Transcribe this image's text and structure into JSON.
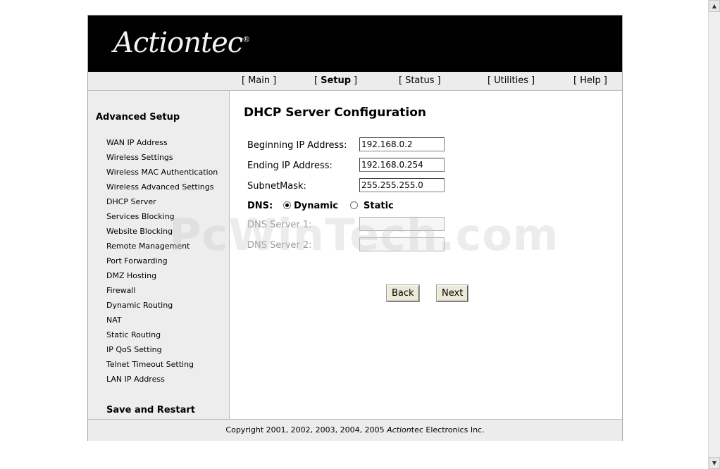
{
  "brand": {
    "logo_text": "Actiontec"
  },
  "topnav": {
    "items": [
      {
        "label": "Main"
      },
      {
        "label": "Setup"
      },
      {
        "label": "Status"
      },
      {
        "label": "Utilities"
      },
      {
        "label": "Help"
      }
    ],
    "active": "Setup"
  },
  "sidebar": {
    "title": "Advanced Setup",
    "items": [
      "WAN IP Address",
      "Wireless Settings",
      "Wireless MAC Authentication",
      "Wireless Advanced Settings",
      "DHCP Server",
      "Services Blocking",
      "Website Blocking",
      "Remote Management",
      "Port Forwarding",
      "DMZ Hosting",
      "Firewall",
      "Dynamic Routing",
      "NAT",
      "Static Routing",
      "IP QoS Setting",
      "Telnet Timeout Setting",
      "LAN IP Address"
    ],
    "save_restart": "Save and Restart"
  },
  "main": {
    "title": "DHCP Server Configuration",
    "fields": {
      "begin_ip": {
        "label": "Beginning IP Address:",
        "value": "192.168.0.2"
      },
      "end_ip": {
        "label": "Ending IP Address:",
        "value": "192.168.0.254"
      },
      "subnet": {
        "label": "SubnetMask:",
        "value": "255.255.255.0"
      },
      "dns1": {
        "label": "DNS Server 1:",
        "value": ""
      },
      "dns2": {
        "label": "DNS Server 2:",
        "value": ""
      }
    },
    "dns": {
      "label": "DNS:",
      "options": [
        "Dynamic",
        "Static"
      ],
      "selected": "Dynamic"
    },
    "buttons": {
      "back": "Back",
      "next": "Next"
    }
  },
  "footer": {
    "prefix": "Copyright 2001, 2002, 2003, 2004, 2005 ",
    "brand": "Action",
    "suffix": "tec Electronics Inc."
  },
  "watermark": "PcWinTech.com"
}
